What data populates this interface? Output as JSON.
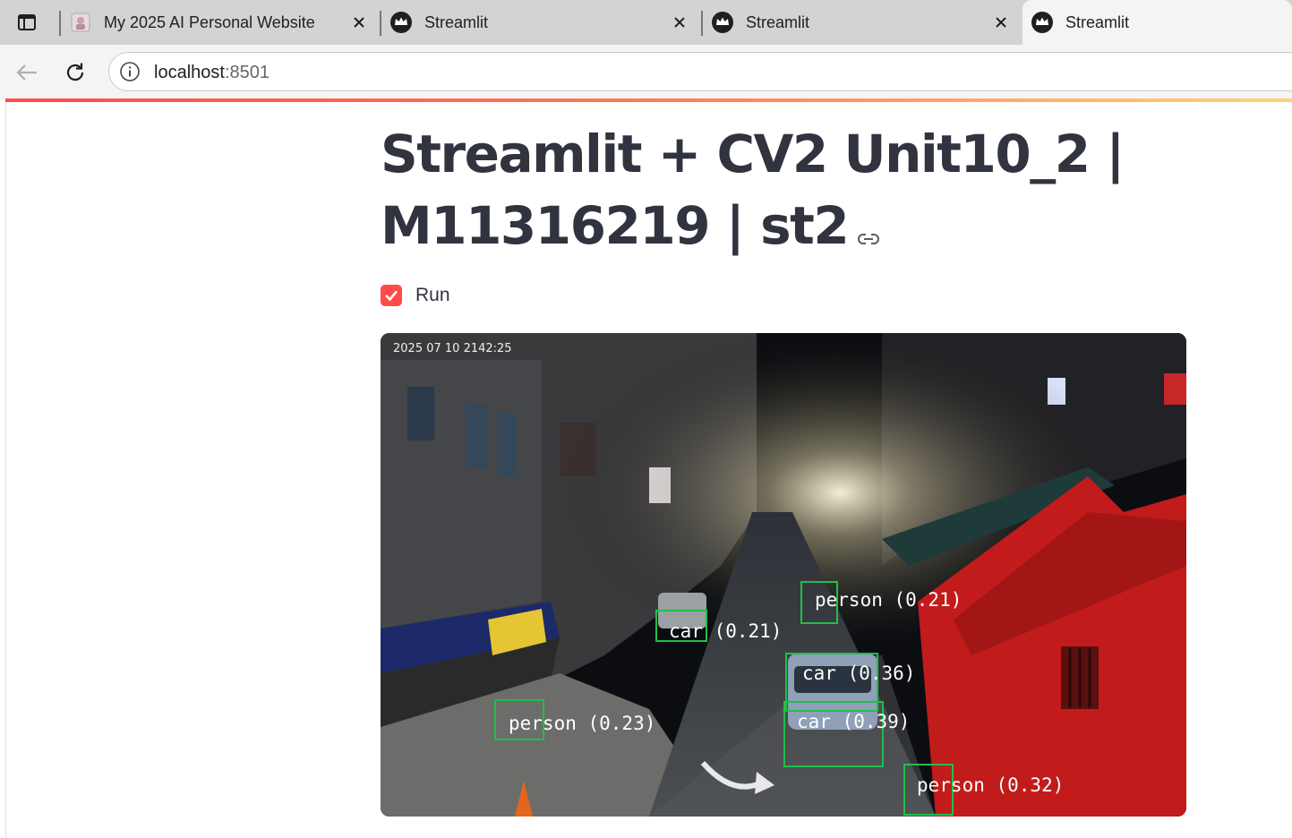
{
  "browser": {
    "tabs": [
      {
        "title": "My 2025 AI Personal Website",
        "active": false
      },
      {
        "title": "Streamlit",
        "active": false
      },
      {
        "title": "Streamlit",
        "active": false
      },
      {
        "title": "Streamlit",
        "active": true
      }
    ],
    "url_host": "localhost",
    "url_port": ":8501"
  },
  "app": {
    "title_line1": "Streamlit + CV2 Unit10_2 |",
    "title_line2": "M11316219 | st2",
    "run_label": "Run",
    "run_checked": true,
    "accent": "#ff4b4b"
  },
  "video": {
    "timestamp": "2025 07 10 2142:25",
    "detections": [
      {
        "label": "person (0.21)"
      },
      {
        "label": "car (0.21)"
      },
      {
        "label": "car (0.36)"
      },
      {
        "label": "person (0.23)"
      },
      {
        "label": "car (0.39)"
      },
      {
        "label": "person (0.32)"
      }
    ],
    "box_color": "#1fbf4a"
  }
}
